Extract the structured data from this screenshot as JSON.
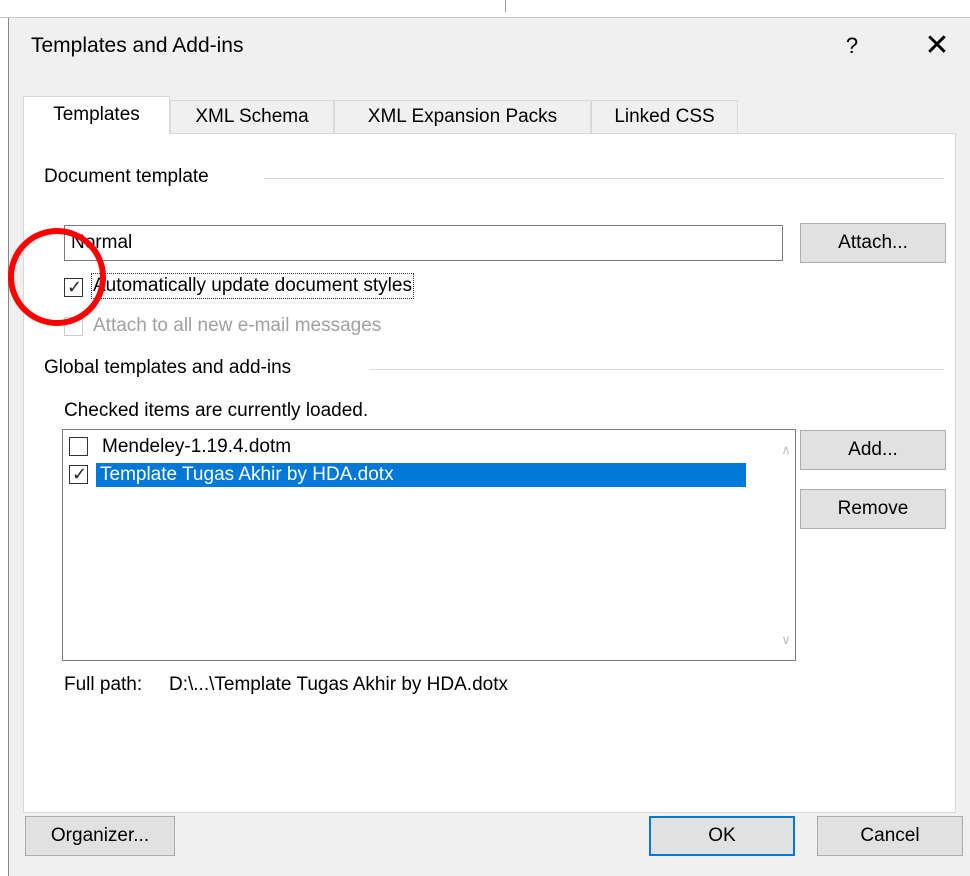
{
  "dialog": {
    "title": "Templates and Add-ins",
    "help_label": "?",
    "close_label": "✕"
  },
  "tabs": [
    {
      "label": "Templates",
      "active": true
    },
    {
      "label": "XML Schema",
      "active": false
    },
    {
      "label": "XML Expansion Packs",
      "active": false
    },
    {
      "label": "Linked CSS",
      "active": false
    }
  ],
  "document_template": {
    "group_label": "Document template",
    "value": "Normal",
    "attach_label": "Attach...",
    "auto_update_label": "Automatically update document styles",
    "auto_update_checked": true,
    "attach_email_label": "Attach to all new e-mail messages",
    "attach_email_checked": false,
    "attach_email_enabled": false
  },
  "global_templates": {
    "group_label": "Global templates and add-ins",
    "hint": "Checked items are currently loaded.",
    "items": [
      {
        "label": "Mendeley-1.19.4.dotm",
        "checked": false,
        "selected": false
      },
      {
        "label": "Template Tugas Akhir by HDA.dotx",
        "checked": true,
        "selected": true
      }
    ],
    "add_label": "Add...",
    "remove_label": "Remove",
    "full_path_label": "Full path:",
    "full_path_value": "D:\\...\\Template Tugas Akhir by HDA.dotx"
  },
  "footer": {
    "organizer_label": "Organizer...",
    "ok_label": "OK",
    "cancel_label": "Cancel"
  },
  "colors": {
    "selection": "#0078d7",
    "annotation": "#ff0000"
  }
}
